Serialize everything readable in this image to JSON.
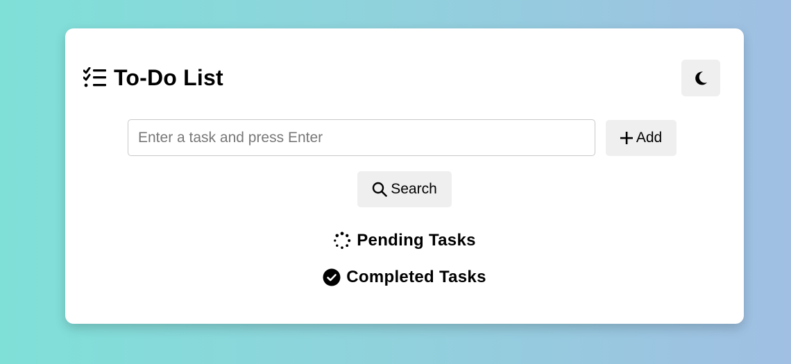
{
  "app": {
    "title": "To-Do List",
    "title_icon": "list-check-icon",
    "theme_toggle_icon": "moon-icon"
  },
  "task_form": {
    "input_value": "",
    "input_placeholder": "Enter a task and press Enter",
    "add_label": "Add",
    "add_icon": "plus-icon"
  },
  "search": {
    "label": "Search",
    "icon": "magnifier-icon"
  },
  "sections": {
    "pending": {
      "label": "Pending Tasks",
      "icon": "spinner-icon"
    },
    "completed": {
      "label": "Completed Tasks",
      "icon": "check-circle-icon"
    }
  },
  "colors": {
    "gradient_start": "#7fe0d8",
    "gradient_end": "#a0bfe3",
    "card_background": "#ffffff",
    "button_background": "#efefef"
  }
}
